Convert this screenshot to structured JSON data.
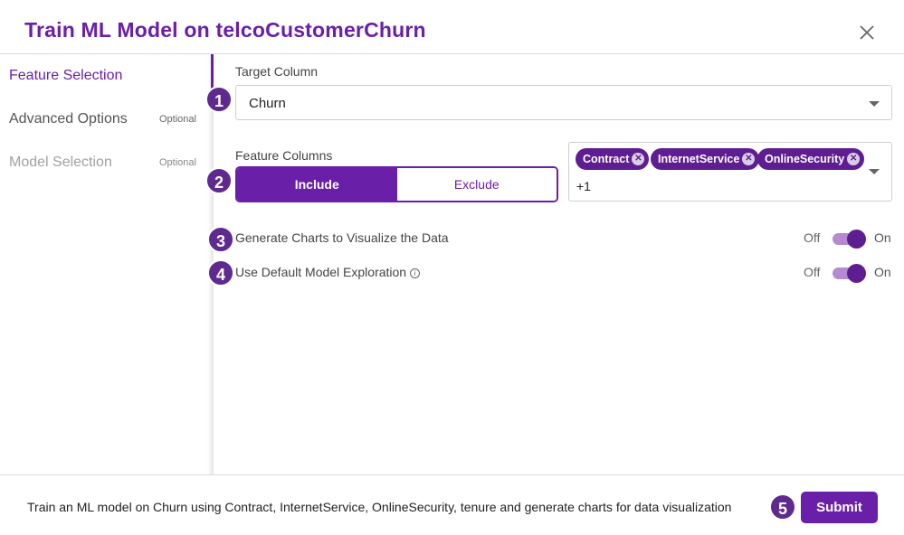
{
  "dialog": {
    "title": "Train ML Model on telcoCustomerChurn",
    "close_icon": "close-icon"
  },
  "sidebar": {
    "steps": [
      {
        "label": "Feature Selection",
        "optional": "",
        "state": "active"
      },
      {
        "label": "Advanced Options",
        "optional": "Optional",
        "state": "enabled"
      },
      {
        "label": "Model Selection",
        "optional": "Optional",
        "state": "disabled"
      }
    ]
  },
  "form": {
    "target_column": {
      "label": "Target Column",
      "value": "Churn"
    },
    "feature_columns": {
      "label": "Feature Columns",
      "modes": [
        "Include",
        "Exclude"
      ],
      "selected_mode": "Include",
      "chips": [
        "Contract",
        "InternetService",
        "OnlineSecurity"
      ],
      "more": "+1"
    },
    "toggles": [
      {
        "label": "Generate Charts to Visualize the Data",
        "off": "Off",
        "on": "On",
        "value": true
      },
      {
        "label": "Use Default Model Exploration",
        "off": "Off",
        "on": "On",
        "value": true,
        "info_icon": "info-icon"
      }
    ]
  },
  "badges": [
    "1",
    "2",
    "3",
    "4",
    "5"
  ],
  "footer": {
    "summary": "Train an ML model on Churn using Contract, InternetService, OnlineSecurity, tenure and generate charts for data visualization",
    "submit_label": "Submit"
  },
  "colors": {
    "accent": "#6a1fa8",
    "badge": "#5e2a8f",
    "toggle_track": "#b48ad0"
  }
}
